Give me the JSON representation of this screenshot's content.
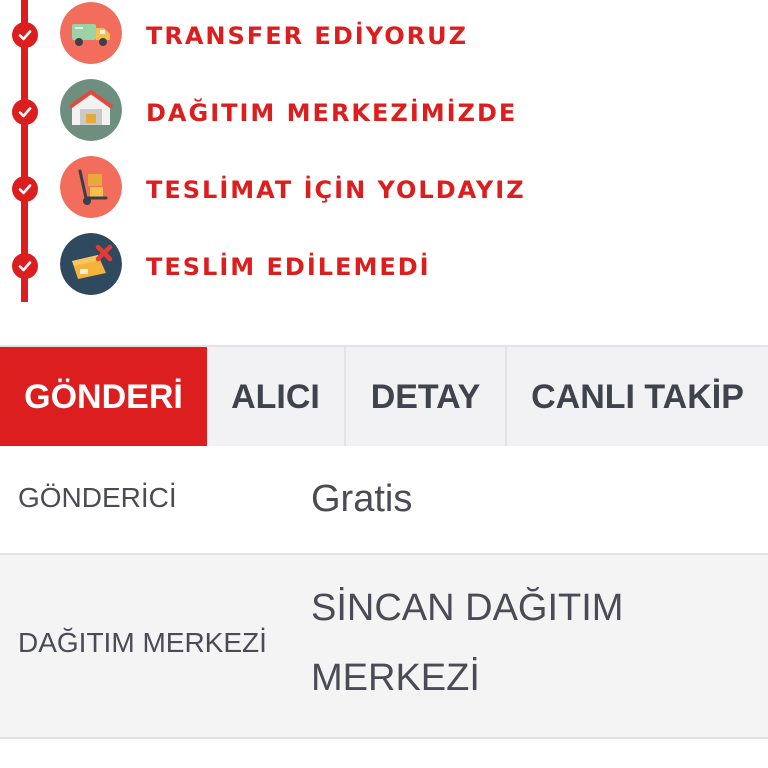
{
  "timeline": {
    "steps": [
      {
        "label": "TRANSFER EDİYORUZ",
        "icon": "delivery-truck-icon"
      },
      {
        "label": "DAĞITIM MERKEZİMİZDE",
        "icon": "warehouse-icon"
      },
      {
        "label": "TESLİMAT İÇİN YOLDAYIZ",
        "icon": "hand-truck-icon"
      },
      {
        "label": "TESLİM EDİLEMEDİ",
        "icon": "failed-package-icon"
      }
    ],
    "accent": "#dc1e1e"
  },
  "tabs": [
    {
      "label": "GÖNDERİ",
      "active": true
    },
    {
      "label": "ALICI",
      "active": false
    },
    {
      "label": "DETAY",
      "active": false
    },
    {
      "label": "CANLI TAKİP",
      "active": false
    }
  ],
  "details": [
    {
      "label": "GÖNDERİCİ",
      "value": "Gratis"
    },
    {
      "label": "DAĞITIM MERKEZİ",
      "value": "SİNCAN DAĞITIM MERKEZİ"
    }
  ]
}
